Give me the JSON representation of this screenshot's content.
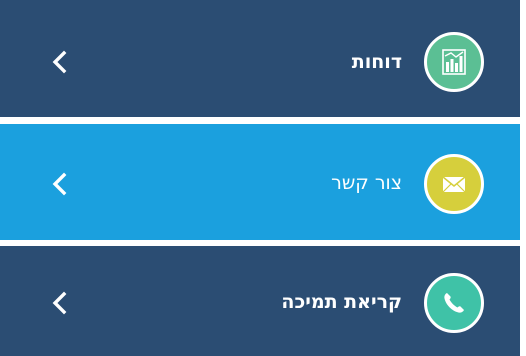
{
  "menu": {
    "items": [
      {
        "label": "דוחות",
        "icon": "bar-chart-icon",
        "background": "#2b4d73",
        "circle_color": "#5bbf94",
        "chevron_icon": "chevron-left-icon"
      },
      {
        "label": "צור קשר",
        "icon": "envelope-icon",
        "background": "#1ba0de",
        "circle_color": "#d6cf3c",
        "chevron_icon": "chevron-left-icon"
      },
      {
        "label": "קריאת תמיכה",
        "icon": "phone-icon",
        "background": "#2b4d73",
        "circle_color": "#3fc2a7",
        "chevron_icon": "chevron-left-icon"
      }
    ]
  }
}
